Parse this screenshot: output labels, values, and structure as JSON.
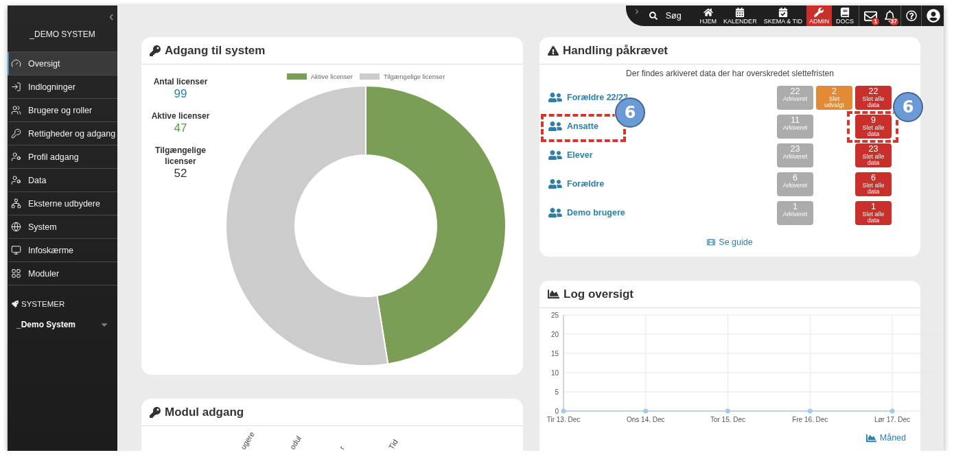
{
  "sidebar": {
    "title": "_DEMO SYSTEM",
    "items": [
      {
        "label": "Oversigt",
        "selected": true
      },
      {
        "label": "Indlogninger",
        "selected": false
      },
      {
        "label": "Brugere og roller",
        "selected": false
      },
      {
        "label": "Rettigheder og adgang",
        "selected": false
      },
      {
        "label": "Profil adgang",
        "selected": false
      },
      {
        "label": "Data",
        "selected": false
      },
      {
        "label": "Eksterne udbydere",
        "selected": false
      },
      {
        "label": "System",
        "selected": false
      },
      {
        "label": "Infoskærme",
        "selected": false
      },
      {
        "label": "Moduler",
        "selected": false
      }
    ],
    "systems_heading": "SYSTEMER",
    "system_select": {
      "value": "_Demo System"
    }
  },
  "top_bar": {
    "search_label": "Søg",
    "nav": [
      {
        "label": "HJEM",
        "selected": false
      },
      {
        "label": "KALENDER",
        "selected": false
      },
      {
        "label": "SKEMA & TID",
        "selected": false
      },
      {
        "label": "ADMIN",
        "selected": true
      },
      {
        "label": "DOCS",
        "selected": false
      }
    ],
    "mail_badge": "1",
    "notification_badge": "37"
  },
  "access_card": {
    "title": "Adgang til system",
    "stats": [
      {
        "label": "Antal licenser",
        "value": "99",
        "color": "#2c80ad"
      },
      {
        "label": "Aktive licenser",
        "value": "47",
        "color": "#5b9a3c"
      },
      {
        "label": "Tilgængelige licenser",
        "value": "52",
        "color": "#333333"
      }
    ],
    "chart_data": {
      "type": "donut",
      "categories": [
        "Aktive licenser",
        "Tilgængelige licenser"
      ],
      "colors": [
        "#7a9e55",
        "#cccccc"
      ],
      "series": [
        {
          "values": [
            47,
            52
          ]
        }
      ],
      "legend": "top"
    }
  },
  "action_card": {
    "title": "Handling påkrævet",
    "subtitle": "Der findes arkiveret data der har overskredet slettefristen",
    "rows": [
      {
        "name": "Forældre 22/23",
        "archived": {
          "count": "22",
          "label": "Arkiveret"
        },
        "delete_selected": {
          "count": "2",
          "label": "Slet udvalgt"
        },
        "delete_all": {
          "count": "22",
          "label": "Slet alle data"
        }
      },
      {
        "name": "Ansatte",
        "name_callout": "6",
        "archived": {
          "count": "11",
          "label": "Arkiveret"
        },
        "delete_all": {
          "count": "9",
          "label": "Slet alle data",
          "callout": "6"
        }
      },
      {
        "name": "Elever",
        "archived": {
          "count": "23",
          "label": "Arkiveret"
        },
        "delete_all": {
          "count": "23",
          "label": "Slet alle data"
        }
      },
      {
        "name": "Forældre",
        "archived": {
          "count": "6",
          "label": "Arkiveret"
        },
        "delete_all": {
          "count": "6",
          "label": "Slet alle data"
        }
      },
      {
        "name": "Demo brugere",
        "archived": {
          "count": "1",
          "label": "Arkiveret"
        },
        "delete_all": {
          "count": "1",
          "label": "Slet alle data"
        }
      }
    ],
    "guide_link": "Se guide"
  },
  "module_card": {
    "title": "Modul adgang",
    "column_headers": [
      "ugere",
      "odul",
      "r",
      "Tid"
    ]
  },
  "log_card": {
    "title": "Log oversigt",
    "chart_data": {
      "type": "line",
      "x": [
        "Tir 13. Dec",
        "Ons 14. Dec",
        "Tor 15. Dec",
        "Fre 16. Dec",
        "Lør 17. Dec"
      ],
      "series": [
        {
          "color": "#a6c8ea",
          "values": [
            0,
            0,
            0,
            0,
            0
          ]
        }
      ],
      "ylim": [
        0,
        25
      ],
      "yticks": [
        0,
        5,
        10,
        15,
        20,
        25
      ],
      "grid": true,
      "marker": "circle"
    },
    "period_link": "Måned"
  }
}
